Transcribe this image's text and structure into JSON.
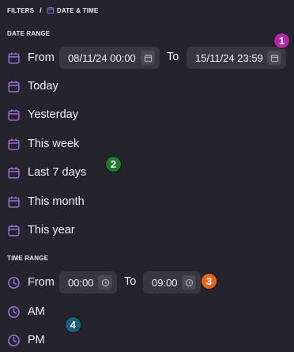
{
  "breadcrumb": {
    "root": "FILTERS",
    "separator": "/",
    "current": "DATE & TIME"
  },
  "date_range": {
    "title": "DATE RANGE",
    "from_label": "From",
    "from_value": "08/11/24 00:00",
    "to_label": "To",
    "to_value": "15/11/24 23:59",
    "presets": [
      "Today",
      "Yesterday",
      "This week",
      "Last 7 days",
      "This month",
      "This year"
    ]
  },
  "time_range": {
    "title": "TIME RANGE",
    "from_label": "From",
    "from_value": "00:00",
    "to_label": "To",
    "to_value": "09:00",
    "presets": [
      "AM",
      "PM"
    ]
  },
  "badges": [
    {
      "label": "1",
      "color": "#b02aa6"
    },
    {
      "label": "2",
      "color": "#1f7a2c"
    },
    {
      "label": "3",
      "color": "#e8641e"
    },
    {
      "label": "4",
      "color": "#1b5f7f"
    }
  ],
  "colors": {
    "accent": "#9b6dd8",
    "background": "#25232b",
    "field": "#38363f"
  },
  "icons": {
    "date": "calendar-icon",
    "time": "clock-icon"
  }
}
